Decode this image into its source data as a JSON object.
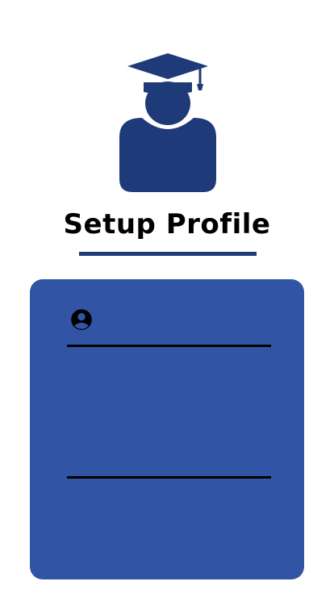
{
  "page": {
    "title": "Setup Profile"
  },
  "form": {
    "name_field": {
      "value": "",
      "placeholder": "",
      "icon": "account-circle-icon"
    },
    "second_field": {
      "value": "",
      "placeholder": ""
    }
  },
  "colors": {
    "avatar": "#1f3a78",
    "accent": "#1f3a78",
    "card": "#3155a4"
  },
  "icons": {
    "header": "graduate-avatar-icon"
  }
}
